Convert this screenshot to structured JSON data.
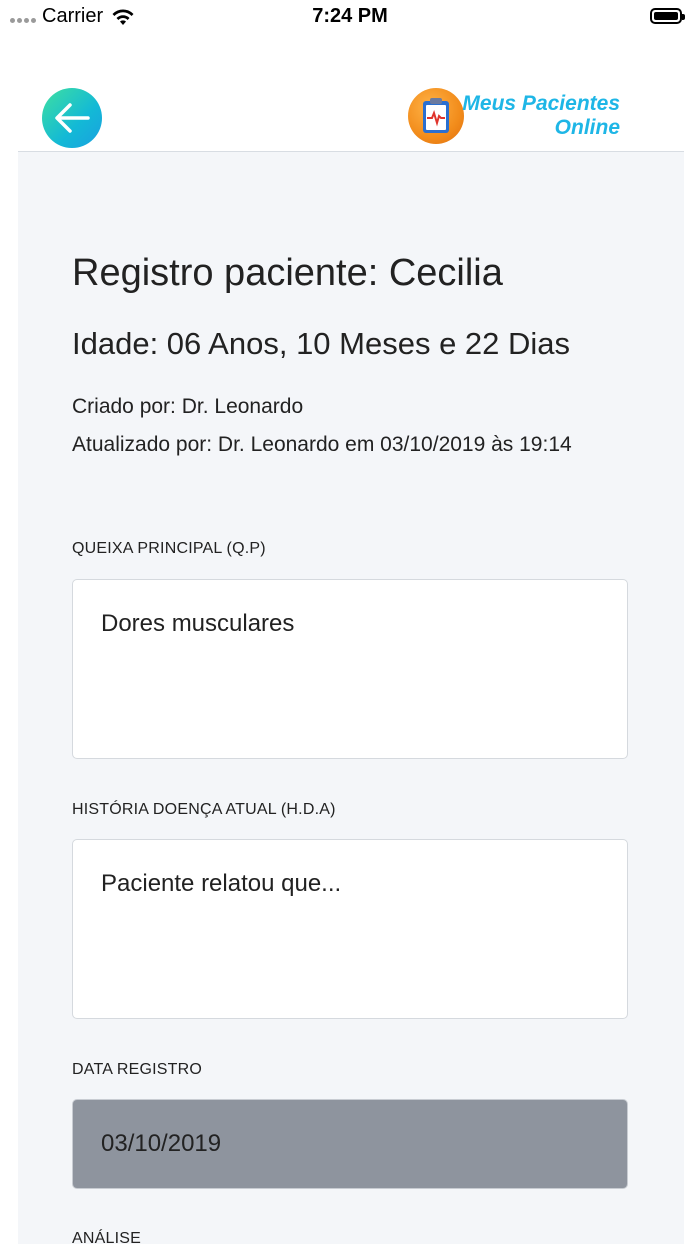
{
  "status_bar": {
    "carrier": "Carrier",
    "time": "7:24 PM"
  },
  "header": {
    "logo_line1": "Meus Pacientes",
    "logo_line2": "Online"
  },
  "record": {
    "title": "Registro paciente: Cecilia",
    "age": "Idade: 06 Anos, 10 Meses e 22 Dias",
    "created_by": "Criado por: Dr. Leonardo",
    "updated_by": "Atualizado por: Dr. Leonardo em 03/10/2019 às 19:14"
  },
  "form": {
    "chief_complaint_label": "QUEIXA PRINCIPAL (Q.P)",
    "chief_complaint_value": "Dores musculares",
    "history_label": "HISTÓRIA DOENÇA ATUAL (H.D.A)",
    "history_value": "Paciente relatou que...",
    "date_label": "DATA REGISTRO",
    "date_value": "03/10/2019",
    "analysis_label": "ANÁLISE"
  },
  "colors": {
    "accent": "#1eb6e6",
    "back_button": "#13b9d6",
    "content_bg": "#f4f6f9",
    "disabled_field": "#8e949e"
  }
}
